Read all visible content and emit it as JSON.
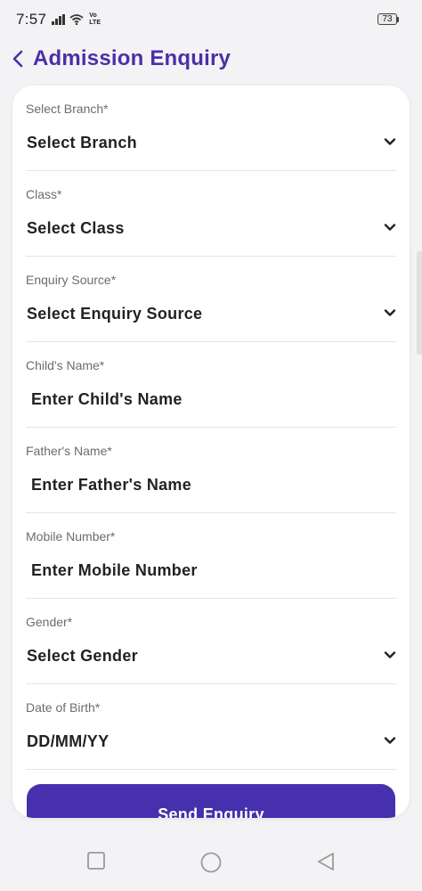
{
  "status_bar": {
    "time": "7:57",
    "network": "Vo LTE",
    "network_top": "Vo",
    "network_bottom": "LTE",
    "battery": "73"
  },
  "header": {
    "title": "Admission Enquiry"
  },
  "form": {
    "fields": [
      {
        "label": "Select Branch*",
        "value": "Select Branch",
        "kind": "dropdown"
      },
      {
        "label": "Class*",
        "value": "Select Class",
        "kind": "dropdown"
      },
      {
        "label": "Enquiry Source*",
        "value": "Select Enquiry Source",
        "kind": "dropdown"
      },
      {
        "label": "Child's Name*",
        "value": "Enter Child's Name",
        "kind": "text"
      },
      {
        "label": "Father's Name*",
        "value": "Enter Father's Name",
        "kind": "text"
      },
      {
        "label": "Mobile Number*",
        "value": "Enter Mobile Number",
        "kind": "text"
      },
      {
        "label": "Gender*",
        "value": "Select Gender",
        "kind": "dropdown"
      },
      {
        "label": "Date of Birth*",
        "value": "DD/MM/YY",
        "kind": "dropdown"
      }
    ],
    "submit_label": "Send Enquiry"
  },
  "colors": {
    "accent": "#4630ad",
    "title": "#4a30a7",
    "background": "#f3f2f5"
  }
}
